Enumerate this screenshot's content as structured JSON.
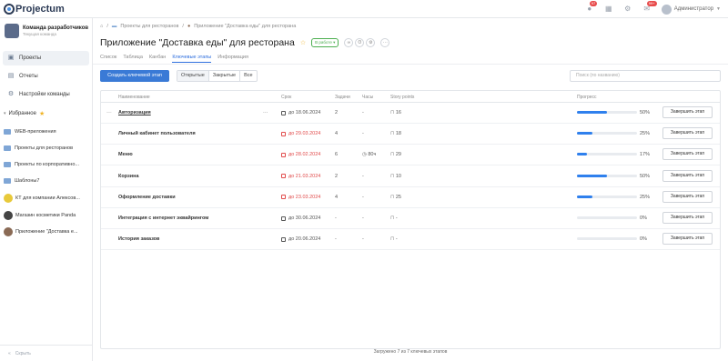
{
  "app": {
    "name": "Projectum"
  },
  "topbar": {
    "notifications_badge": "97",
    "messages_badge": "99+",
    "user_name": "Администратор"
  },
  "sidebar": {
    "team_name": "Команда разработчиков",
    "team_sub": "Текущая команда",
    "nav": [
      {
        "label": "Проекты",
        "icon": "projects-icon",
        "active": true
      },
      {
        "label": "Отчеты",
        "icon": "reports-icon",
        "active": false
      },
      {
        "label": "Настройки команды",
        "icon": "gear-icon",
        "active": false
      }
    ],
    "favorites_label": "Избранное",
    "favorites": [
      {
        "label": "WEB-приложения",
        "type": "folder"
      },
      {
        "label": "Проекты для ресторанов",
        "type": "folder"
      },
      {
        "label": "Проекты по корпоративно...",
        "type": "folder"
      },
      {
        "label": "Шаблоны7",
        "type": "folder"
      },
      {
        "label": "КТ для компании Алексов...",
        "type": "avatar",
        "color": "#e8c93a"
      },
      {
        "label": "Магазин косметики Panda",
        "type": "avatar",
        "color": "#444444"
      },
      {
        "label": "Приложение \"Доставка е...",
        "type": "avatar",
        "color": "#8a6a55"
      }
    ],
    "hide_label": "Скрыть"
  },
  "breadcrumb": {
    "items": [
      "Проекты для ресторанов",
      "Приложение \"Доставка еды\" для ресторана"
    ]
  },
  "project": {
    "title": "Приложение \"Доставка еды\" для ресторана",
    "status": "В работе"
  },
  "tabs": [
    {
      "label": "Список",
      "active": false
    },
    {
      "label": "Таблица",
      "active": false
    },
    {
      "label": "Канбан",
      "active": false
    },
    {
      "label": "Ключевые этапы",
      "active": true
    },
    {
      "label": "Информация",
      "active": false
    }
  ],
  "toolbar": {
    "create_label": "Создать ключевой этап",
    "filters": [
      {
        "label": "Открытые",
        "active": true
      },
      {
        "label": "Закрытые",
        "active": false
      },
      {
        "label": "Все",
        "active": false
      }
    ],
    "search_placeholder": "Поиск (по названию)"
  },
  "table": {
    "headers": {
      "name": "Наименование",
      "deadline": "Срок",
      "tasks": "Задачи",
      "hours": "Часы",
      "story_points": "Story points",
      "progress": "Прогресс"
    },
    "finish_label": "Завершить этап",
    "rows": [
      {
        "name": "Авторизация",
        "deadline": "до 18.06.2024",
        "overdue": false,
        "tasks": "2",
        "hours": "-",
        "sp": "16",
        "progress": 50,
        "pct": "50%"
      },
      {
        "name": "Личный кабинет пользователя",
        "deadline": "до 29.03.2024",
        "overdue": true,
        "tasks": "4",
        "hours": "-",
        "sp": "18",
        "progress": 25,
        "pct": "25%"
      },
      {
        "name": "Меню",
        "deadline": "до 28.02.2024",
        "overdue": true,
        "tasks": "6",
        "hours": "80ч",
        "sp": "29",
        "progress": 17,
        "pct": "17%"
      },
      {
        "name": "Корзина",
        "deadline": "до 21.03.2024",
        "overdue": true,
        "tasks": "2",
        "hours": "-",
        "sp": "10",
        "progress": 50,
        "pct": "50%"
      },
      {
        "name": "Оформление доставки",
        "deadline": "до 23.03.2024",
        "overdue": true,
        "tasks": "4",
        "hours": "-",
        "sp": "25",
        "progress": 25,
        "pct": "25%"
      },
      {
        "name": "Интеграция с интернет эквайрингом",
        "deadline": "до 30.06.2024",
        "overdue": false,
        "tasks": "-",
        "hours": "-",
        "sp": "-",
        "progress": 0,
        "pct": "0%"
      },
      {
        "name": "История заказов",
        "deadline": "до 20.06.2024",
        "overdue": false,
        "tasks": "-",
        "hours": "-",
        "sp": "-",
        "progress": 0,
        "pct": "0%"
      }
    ]
  },
  "footer": {
    "loaded_text": "Загружено 7 из 7 ключевых этапов"
  },
  "colors": {
    "accent": "#2f80ed",
    "overdue": "#e14b4b",
    "status": "#4caf50"
  }
}
